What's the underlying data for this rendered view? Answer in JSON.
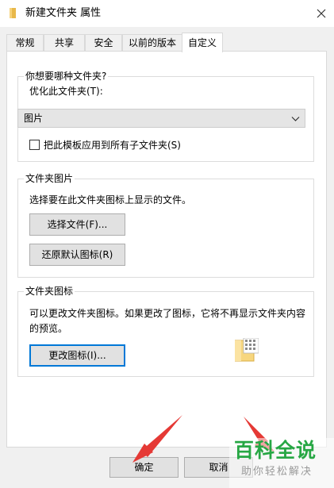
{
  "window": {
    "title": "新建文件夹 属性",
    "folder_icon": "folder-icon",
    "close_icon": "close-icon"
  },
  "tabs": [
    {
      "label": "常规",
      "active": false
    },
    {
      "label": "共享",
      "active": false
    },
    {
      "label": "安全",
      "active": false
    },
    {
      "label": "以前的版本",
      "active": false
    },
    {
      "label": "自定义",
      "active": true
    }
  ],
  "folder_type_group": {
    "title": "你想要哪种文件夹?",
    "optimize_label": "优化此文件夹(T):",
    "selected_option": "图片",
    "apply_checkbox_label": "把此模板应用到所有子文件夹(S)",
    "apply_checked": false
  },
  "folder_picture_group": {
    "title": "文件夹图片",
    "description": "选择要在此文件夹图标上显示的文件。",
    "choose_file_button": "选择文件(F)...",
    "restore_default_button": "还原默认图标(R)"
  },
  "folder_icon_group": {
    "title": "文件夹图标",
    "description": "可以更改文件夹图标。如果更改了图标，它将不再显示文件夹内容的预览。",
    "change_icon_button": "更改图标(I)...",
    "preview_icon": "folder-preview-icon"
  },
  "footer": {
    "ok_button": "确定",
    "cancel_button": "取消"
  },
  "watermark": {
    "main": "百科全说",
    "sub": "助你轻松解决"
  },
  "colors": {
    "accent": "#0078d7",
    "annotation_arrow": "#e53935",
    "watermark_green": "#27a744"
  }
}
